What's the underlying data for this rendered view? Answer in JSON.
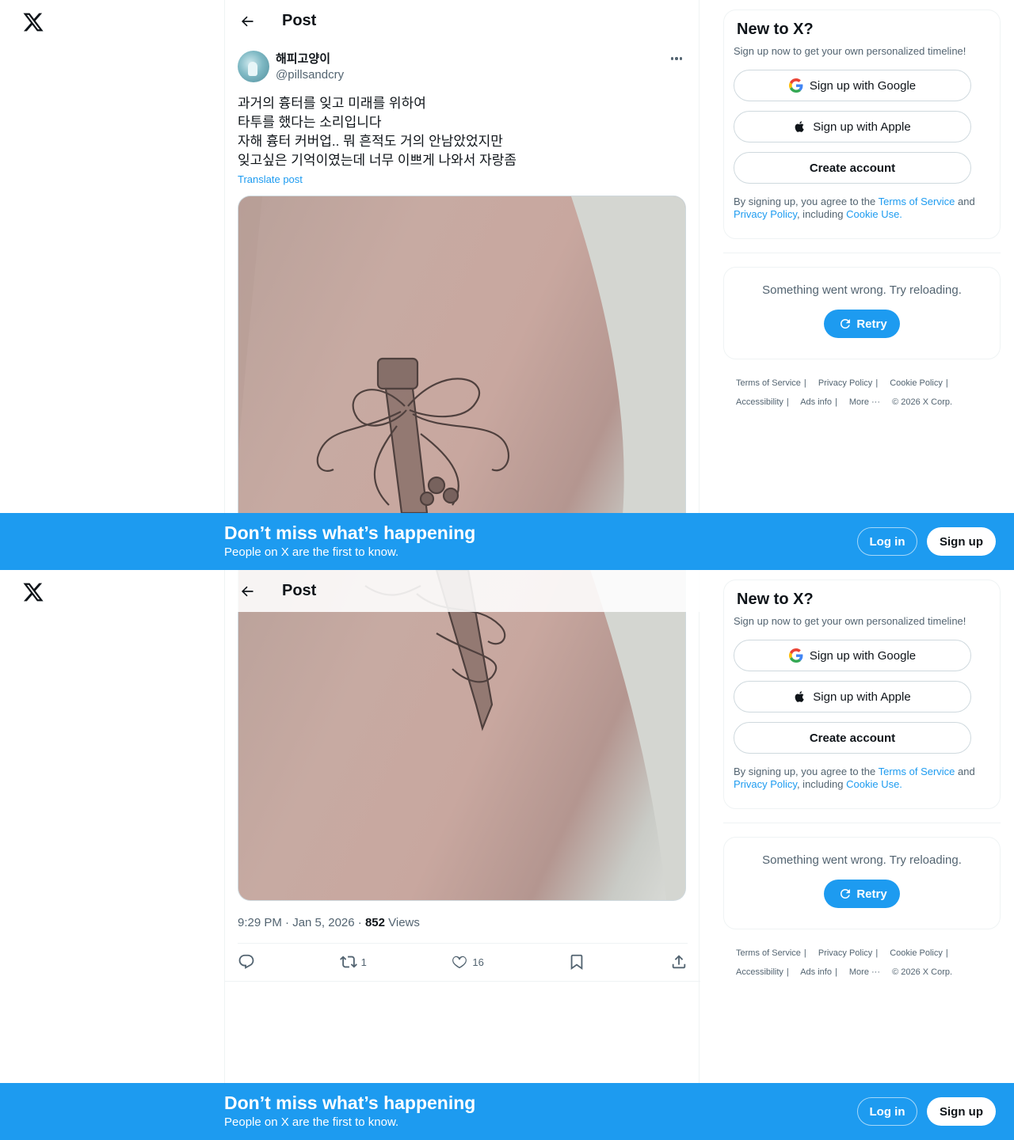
{
  "nav": {
    "logo_icon": "x-logo-icon"
  },
  "header": {
    "title": "Post",
    "back_icon": "arrow-left-icon"
  },
  "post": {
    "display_name": "해피고양이",
    "handle": "@pillsandcry",
    "text_lines": [
      "과거의 흉터를 잊고 미래를 위하여",
      "타투를 했다는 소리입니다",
      "자해 흉터 커버업.. 뭐 흔적도 거의 안남았었지만",
      "잊고싶은 기억이였는데 너무 이쁘게 나와서 자랑좀"
    ],
    "translate_label": "Translate post",
    "time": "9:29 PM · Jan 5, 2026",
    "separator": "·",
    "views_count": "852",
    "views_label": "Views",
    "reposts": "1",
    "likes": "16"
  },
  "sidebar": {
    "signup_title": "New to X?",
    "signup_subtitle": "Sign up now to get your own personalized timeline!",
    "google_label": "Sign up with Google",
    "apple_label": "Sign up with Apple",
    "create_label": "Create account",
    "legal_prefix": "By signing up, you agree to the ",
    "terms_label": "Terms of Service",
    "legal_and": " and ",
    "privacy_label": "Privacy Policy",
    "legal_including": ", including ",
    "cookie_label": "Cookie Use.",
    "error_text": "Something went wrong. Try reloading.",
    "retry_label": "Retry"
  },
  "footer": {
    "links": [
      "Terms of Service",
      "Privacy Policy",
      "Cookie Policy",
      "Accessibility",
      "Ads info",
      "More ···"
    ],
    "copyright": "© 2026 X Corp."
  },
  "banner": {
    "title": "Don’t miss what’s happening",
    "subtitle": "People on X are the first to know.",
    "login_label": "Log in",
    "signup_label": "Sign up"
  },
  "colors": {
    "accent": "#1d9bf0",
    "text": "#0f1419",
    "muted": "#536471",
    "border": "#eff3f4"
  }
}
